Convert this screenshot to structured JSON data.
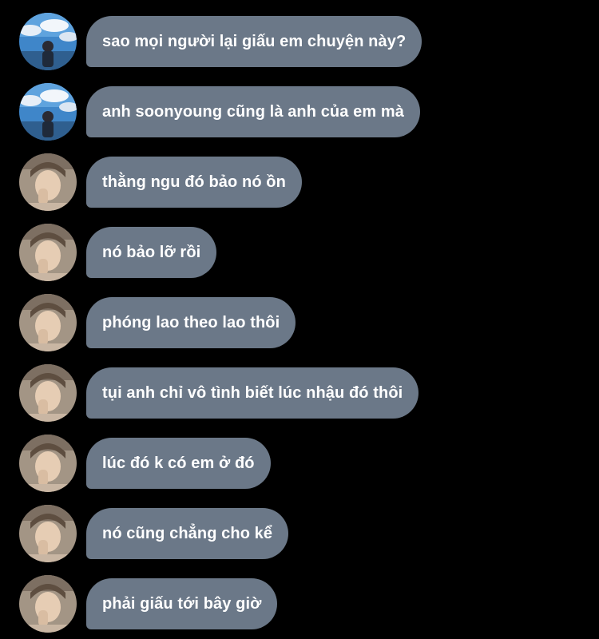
{
  "colors": {
    "background": "#000000",
    "bubble": "#6b7888",
    "text": "#ffffff"
  },
  "messages": [
    {
      "avatar": "sky-avatar-icon",
      "text": "sao mọi người lại giấu em chuyện này?"
    },
    {
      "avatar": "sky-avatar-icon",
      "text": "anh soonyoung cũng là anh của em mà"
    },
    {
      "avatar": "person-avatar-icon",
      "text": "thằng ngu đó bảo nó ồn"
    },
    {
      "avatar": "person-avatar-icon",
      "text": "nó bảo lỡ rồi"
    },
    {
      "avatar": "person-avatar-icon",
      "text": "phóng lao theo lao thôi"
    },
    {
      "avatar": "person-avatar-icon",
      "text": "tụi anh chỉ vô tình biết lúc nhậu đó thôi"
    },
    {
      "avatar": "person-avatar-icon",
      "text": "lúc đó k có em ở đó"
    },
    {
      "avatar": "person-avatar-icon",
      "text": "nó cũng chẳng cho kể"
    },
    {
      "avatar": "person-avatar-icon",
      "text": "phải giấu tới bây giờ"
    }
  ]
}
